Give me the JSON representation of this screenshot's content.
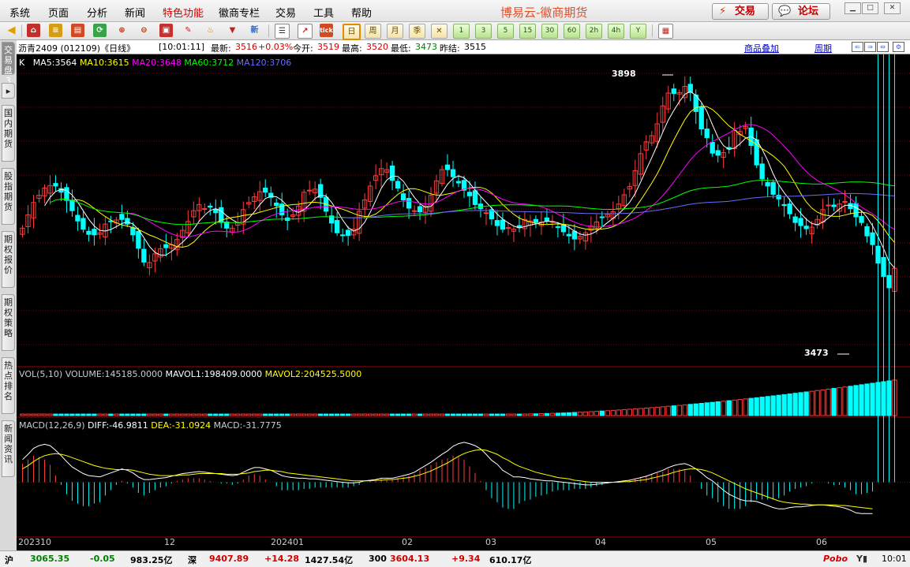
{
  "menu": {
    "items": [
      "系统",
      "页面",
      "分析",
      "新闻",
      "特色功能",
      "徽商专栏",
      "交易",
      "工具",
      "帮助"
    ],
    "app_title": "博易云-徽商期货",
    "trade_button": "交易",
    "forum_button": "论坛"
  },
  "toolbar": {
    "periods": [
      "日",
      "周",
      "月",
      "季",
      "1",
      "3",
      "5",
      "15",
      "30",
      "60",
      "2h",
      "4h",
      "Y"
    ]
  },
  "sidetabs": [
    "交易盘3",
    "国内期货",
    "股指期货",
    "期权报价",
    "期权策略",
    "热点排名",
    "新闻资讯"
  ],
  "header": {
    "symbol": "沥青2409 (012109)《日线》",
    "time": "[10:01:11]",
    "latest_label": "最新:",
    "latest": "3516",
    "change": "+0.03%",
    "open_label": "今开:",
    "open": "3519",
    "high_label": "最高:",
    "high": "3520",
    "low_label": "最低:",
    "low": "3473",
    "prev_label": "昨结:",
    "prev": "3515",
    "link_overlay": "商品叠加",
    "link_period": "周期"
  },
  "ma_legend": {
    "k": "K",
    "ma5": "MA5:3564",
    "ma10": "MA10:3615",
    "ma20": "MA20:3648",
    "ma60": "MA60:3712",
    "ma120": "MA120:3706"
  },
  "vol_legend": {
    "label": "VOL(5,10)",
    "volume": "VOLUME:145185.0000",
    "mavol1": "MAVOL1:198409.0000",
    "mavol2": "MAVOL2:204525.5000"
  },
  "macd_legend": {
    "label": "MACD(12,26,9)",
    "diff": "DIFF:-46.9811",
    "dea": "DEA:-31.0924",
    "macd": "MACD:-31.7775"
  },
  "price_annotations": {
    "high": "3898",
    "low": "3473"
  },
  "x_axis": [
    "202310",
    "12",
    "202401",
    "02",
    "03",
    "04",
    "05",
    "06"
  ],
  "status": {
    "sh_label": "沪",
    "sh_index": "3065.35",
    "sh_change": "-0.05",
    "sh_amount": "983.25亿",
    "sz_label": "深",
    "sz_index": "9407.89",
    "sz_change": "+14.28",
    "sz_amount": "1427.54亿",
    "hs300_label": "300",
    "hs300_index": "3604.13",
    "hs300_change": "+9.34",
    "hs300_amount": "610.17亿",
    "brand": "Pobo",
    "clock": "10:01"
  },
  "colors": {
    "up": "#ff3c3c",
    "down": "#00ffff",
    "ma5": "#ffffff",
    "ma10": "#ffff00",
    "ma20": "#ff00ff",
    "ma60": "#00ff00",
    "ma120": "#6a6aff",
    "grid": "#8b0000"
  },
  "chart_data": {
    "type": "candlestick",
    "price_range": [
      3330,
      3930
    ],
    "volume_range": [
      0,
      1
    ],
    "macd_range": [
      -80,
      80
    ],
    "closes": [
      3598,
      3624,
      3648,
      3662,
      3676,
      3681,
      3680,
      3668,
      3652,
      3632,
      3612,
      3596,
      3586,
      3585,
      3589,
      3606,
      3611,
      3614,
      3615,
      3606,
      3585,
      3559,
      3532,
      3531,
      3548,
      3558,
      3560,
      3566,
      3576,
      3594,
      3611,
      3632,
      3644,
      3636,
      3639,
      3628,
      3609,
      3598,
      3598,
      3609,
      3634,
      3648,
      3659,
      3669,
      3668,
      3658,
      3642,
      3624,
      3613,
      3624,
      3641,
      3668,
      3672,
      3674,
      3658,
      3631,
      3608,
      3589,
      3584,
      3584,
      3596,
      3631,
      3653,
      3680,
      3700,
      3714,
      3712,
      3691,
      3676,
      3653,
      3637,
      3632,
      3630,
      3641,
      3662,
      3690,
      3712,
      3712,
      3698,
      3686,
      3672,
      3661,
      3644,
      3636,
      3628,
      3616,
      3603,
      3596,
      3599,
      3596,
      3599,
      3615,
      3612,
      3609,
      3610,
      3612,
      3611,
      3600,
      3591,
      3583,
      3577,
      3582,
      3589,
      3602,
      3610,
      3619,
      3625,
      3630,
      3645,
      3663,
      3679,
      3710,
      3743,
      3766,
      3778,
      3801,
      3836,
      3861,
      3860,
      3862,
      3874,
      3862,
      3825,
      3791,
      3774,
      3744,
      3740,
      3745,
      3752,
      3788,
      3786,
      3796,
      3759,
      3721,
      3694,
      3680,
      3664,
      3655,
      3642,
      3626,
      3609,
      3603,
      3597,
      3600,
      3615,
      3634,
      3643,
      3640,
      3645,
      3650,
      3636,
      3620,
      3609,
      3583,
      3566,
      3530,
      3504,
      3482,
      3520
    ],
    "macd_diff": [
      34,
      42,
      51,
      55,
      57,
      55,
      48,
      40,
      31,
      23,
      18,
      13,
      10,
      9,
      8,
      11,
      14,
      17,
      20,
      18,
      14,
      8,
      4,
      4,
      5,
      6,
      7,
      9,
      11,
      13,
      14,
      15,
      16,
      15,
      14,
      13,
      12,
      11,
      10,
      11,
      15,
      19,
      22,
      22,
      20,
      18,
      14,
      10,
      8,
      7,
      6,
      6,
      5,
      5,
      4,
      3,
      2,
      1,
      0,
      -1,
      -1,
      0,
      2,
      3,
      4,
      6,
      6,
      6,
      8,
      10,
      12,
      15,
      20,
      25,
      30,
      36,
      42,
      47,
      54,
      58,
      60,
      58,
      55,
      50,
      42,
      33,
      27,
      18,
      13,
      8,
      8,
      7,
      5,
      4,
      3,
      2,
      2,
      1,
      0,
      -1,
      -2,
      -3,
      -4,
      -4,
      -3,
      -2,
      -1,
      0,
      1,
      2,
      3,
      5,
      7,
      9,
      12,
      15,
      18,
      22,
      25,
      27,
      28,
      25,
      20,
      14,
      7,
      2,
      -5,
      -12,
      -18,
      -22,
      -26,
      -28,
      -28,
      -29,
      -32,
      -35,
      -38,
      -40,
      -40,
      -38,
      -37,
      -37,
      -36,
      -35,
      -34,
      -34,
      -35,
      -36,
      -37,
      -39,
      -42,
      -46,
      -47,
      -47,
      -47
    ],
    "macd_dea": [
      20,
      25,
      31,
      36,
      40,
      42,
      43,
      42,
      40,
      37,
      34,
      31,
      28,
      25,
      23,
      21,
      20,
      19,
      19,
      19,
      18,
      16,
      14,
      12,
      11,
      10,
      10,
      10,
      10,
      11,
      11,
      12,
      13,
      13,
      13,
      13,
      13,
      12,
      12,
      12,
      13,
      14,
      16,
      17,
      18,
      18,
      17,
      16,
      14,
      13,
      12,
      11,
      10,
      9,
      8,
      7,
      6,
      5,
      4,
      3,
      2,
      2,
      2,
      2,
      3,
      3,
      4,
      4,
      5,
      6,
      7,
      9,
      11,
      14,
      17,
      21,
      25,
      29,
      34,
      39,
      43,
      46,
      48,
      49,
      48,
      45,
      42,
      37,
      33,
      28,
      24,
      21,
      18,
      15,
      13,
      11,
      9,
      7,
      6,
      5,
      3,
      2,
      1,
      0,
      0,
      0,
      0,
      0,
      0,
      1,
      1,
      2,
      3,
      4,
      6,
      8,
      10,
      12,
      15,
      17,
      19,
      20,
      20,
      19,
      17,
      14,
      10,
      6,
      2,
      -2,
      -6,
      -10,
      -13,
      -16,
      -19,
      -22,
      -25,
      -28,
      -30,
      -31,
      -32,
      -33,
      -33,
      -34,
      -34,
      -34,
      -34,
      -34,
      -35,
      -35,
      -36,
      -37,
      -38,
      -39,
      -40
    ],
    "xlabels": [
      "202310",
      "12",
      "202401",
      "02",
      "03",
      "04",
      "05",
      "06"
    ]
  }
}
